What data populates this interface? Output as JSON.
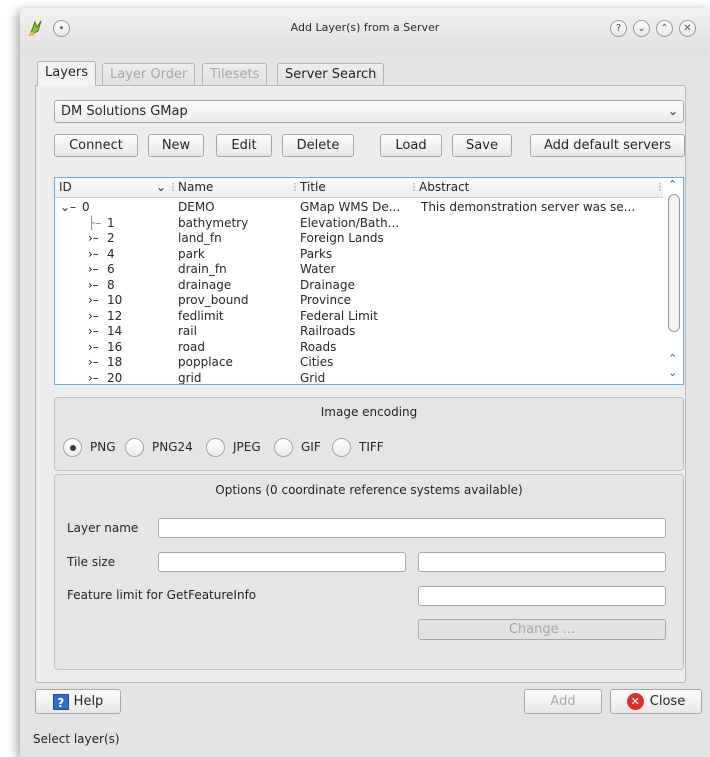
{
  "window": {
    "title": "Add Layer(s) from a Server"
  },
  "tabs": [
    {
      "label": "Layers",
      "state": "active"
    },
    {
      "label": "Layer Order",
      "state": "disabled"
    },
    {
      "label": "Tilesets",
      "state": "disabled"
    },
    {
      "label": "Server Search",
      "state": "enabled"
    }
  ],
  "server_combo": {
    "selected": "DM Solutions GMap"
  },
  "connection_buttons": {
    "connect": "Connect",
    "new": "New",
    "edit": "Edit",
    "delete": "Delete",
    "load": "Load",
    "save": "Save",
    "add_default": "Add default servers"
  },
  "layer_tree": {
    "columns": [
      "ID",
      "Name",
      "Title",
      "Abstract"
    ],
    "rows": [
      {
        "id": "0",
        "name": "DEMO",
        "title": "GMap WMS De...",
        "abstract": "This demonstration server was se..."
      },
      {
        "id": "1",
        "name": "bathymetry",
        "title": "Elevation/Bath...",
        "abstract": ""
      },
      {
        "id": "2",
        "name": "land_fn",
        "title": "Foreign Lands",
        "abstract": ""
      },
      {
        "id": "4",
        "name": "park",
        "title": "Parks",
        "abstract": ""
      },
      {
        "id": "6",
        "name": "drain_fn",
        "title": "Water",
        "abstract": ""
      },
      {
        "id": "8",
        "name": "drainage",
        "title": "Drainage",
        "abstract": ""
      },
      {
        "id": "10",
        "name": "prov_bound",
        "title": "Province",
        "abstract": ""
      },
      {
        "id": "12",
        "name": "fedlimit",
        "title": "Federal Limit",
        "abstract": ""
      },
      {
        "id": "14",
        "name": "rail",
        "title": "Railroads",
        "abstract": ""
      },
      {
        "id": "16",
        "name": "road",
        "title": "Roads",
        "abstract": ""
      },
      {
        "id": "18",
        "name": "popplace",
        "title": "Cities",
        "abstract": ""
      },
      {
        "id": "20",
        "name": "grid",
        "title": "Grid",
        "abstract": ""
      }
    ]
  },
  "image_encoding": {
    "title": "Image encoding",
    "options": [
      "PNG",
      "PNG24",
      "JPEG",
      "GIF",
      "TIFF"
    ],
    "selected": "PNG"
  },
  "options": {
    "title": "Options (0 coordinate reference systems available)",
    "layer_name_label": "Layer name",
    "tile_size_label": "Tile size",
    "feature_limit_label": "Feature limit for GetFeatureInfo",
    "change_button": "Change ...",
    "layer_name_value": "",
    "tile_width_value": "",
    "tile_height_value": "",
    "feature_limit_value": ""
  },
  "bottom": {
    "help": "Help",
    "add": "Add",
    "close": "Close",
    "status": "Select layer(s)"
  },
  "colors": {
    "window_bg": "#e4e3e2",
    "tree_focus_border": "#6aa9d8",
    "close_icon": "#d9312b",
    "help_icon": "#2c6fc7"
  }
}
